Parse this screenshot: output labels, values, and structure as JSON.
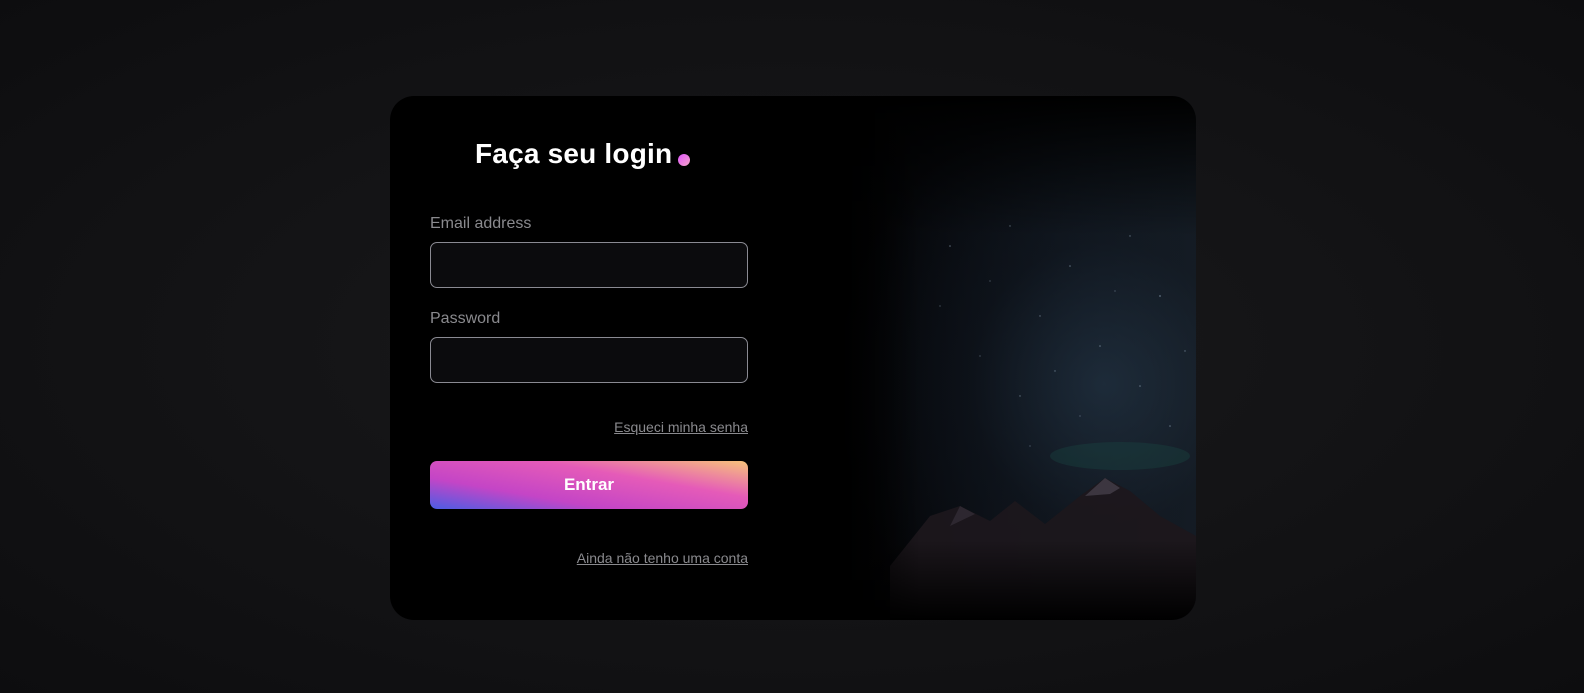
{
  "login": {
    "title": "Faça seu login",
    "email_label": "Email address",
    "email_value": "",
    "password_label": "Password",
    "password_value": "",
    "forgot_link": "Esqueci minha senha",
    "submit_label": "Entrar",
    "signup_link": "Ainda não tenho uma conta"
  },
  "colors": {
    "background": "#111113",
    "card": "#000000",
    "input_border": "#8a8a92",
    "muted_text": "#8a8a8e",
    "button_gradient": [
      "#4b5de4",
      "#c445c6",
      "#e55bb8",
      "#f7c37a"
    ]
  },
  "icons": {
    "title_accent": "gradient-dot-icon",
    "background_image": "night-sky-mountains-image"
  }
}
